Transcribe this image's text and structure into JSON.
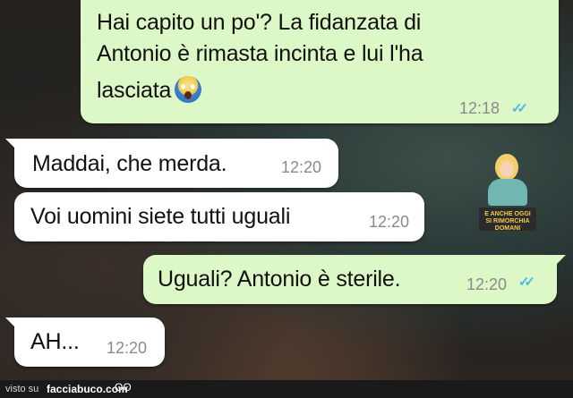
{
  "messages": [
    {
      "text_line1": "Hai capito un po'? La fidanzata di",
      "text_line2": "Antonio è rimasta incinta e lui l'ha",
      "text_line3": "lasciata",
      "emoji": "scream-emoji",
      "time": "12:18",
      "ticks": "✓✓",
      "direction": "outgoing"
    },
    {
      "text": "Maddai, che merda.",
      "time": "12:20",
      "direction": "incoming"
    },
    {
      "text": "Voi uomini siete tutti uguali",
      "time": "12:20",
      "direction": "incoming"
    },
    {
      "text": "Uguali? Antonio è sterile.",
      "time": "12:20",
      "ticks": "✓✓",
      "direction": "outgoing"
    },
    {
      "text": "AH...",
      "time": "12:20",
      "direction": "incoming"
    }
  ],
  "watermark": {
    "line1": "E ANCHE OGGI",
    "line2": "SI RIMORCHIA DOMANI"
  },
  "footer": {
    "label": "visto su",
    "site": "facciabuco.com",
    "mascot": "ʘʘ"
  },
  "colors": {
    "outgoing_bubble": "#dcf8c6",
    "incoming_bubble": "#ffffff",
    "read_ticks": "#4fb6ec",
    "timestamp": "#8a8a8a"
  }
}
